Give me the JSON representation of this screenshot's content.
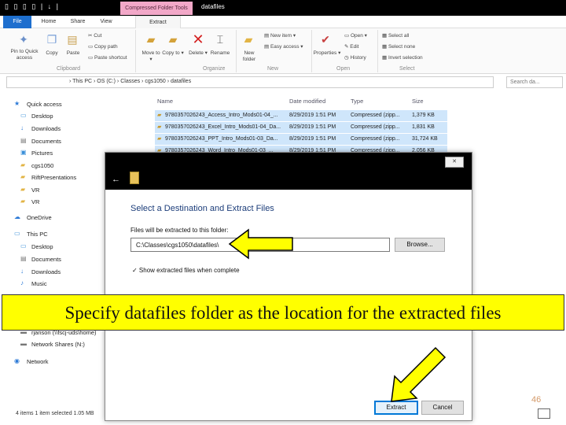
{
  "titlebar": {
    "qat": "▯ ▯ ▯ ▯ | ↓ |",
    "context_tab": "Compressed Folder Tools",
    "window_title": "datafiles"
  },
  "ribbon_tabs": [
    "File",
    "Home",
    "Share",
    "View",
    "Extract"
  ],
  "ribbon": {
    "pin_label": "Pin to Quick access",
    "copy_label": "Copy",
    "paste_label": "Paste",
    "cut_label": "Cut",
    "copy_path_label": "Copy path",
    "paste_shortcut_label": "Paste shortcut",
    "move_to_label": "Move to ▾",
    "copy_to_label": "Copy to ▾",
    "delete_label": "Delete ▾",
    "rename_label": "Rename",
    "new_folder_label": "New folder",
    "new_item_label": "New item ▾",
    "easy_access_label": "Easy access ▾",
    "properties_label": "Properties ▾",
    "open_label": "Open ▾",
    "edit_label": "Edit",
    "history_label": "History",
    "select_all_label": "Select all",
    "select_none_label": "Select none",
    "invert_selection_label": "Invert selection",
    "groups": [
      "Clipboard",
      "Organize",
      "New",
      "Open",
      "Select"
    ]
  },
  "address": {
    "path": "› This PC › OS (C:) › Classes › cgs1050 › datafiles",
    "search_placeholder": "Search da..."
  },
  "nav": {
    "items": [
      "Quick access",
      "Desktop",
      "Downloads",
      "Documents",
      "Pictures",
      "cgs1050",
      "RiftPresentations",
      "VR",
      "VR",
      "OneDrive",
      "This PC",
      "Desktop",
      "Documents",
      "Downloads",
      "Music",
      "rjanson (\\\\fscj-uds\\home)",
      "Network Shares (N:)",
      "Network"
    ]
  },
  "file_list": {
    "headers": [
      "Name",
      "Date modified",
      "Type",
      "Size"
    ],
    "rows": [
      {
        "name": "9780357026243_Access_Intro_Mods01-04_...",
        "date": "8/29/2019 1:51 PM",
        "type": "Compressed (zipp...",
        "size": "1,379 KB"
      },
      {
        "name": "9780357026243_Excel_Intro_Mods01-04_Da...",
        "date": "8/29/2019 1:51 PM",
        "type": "Compressed (zipp...",
        "size": "1,831 KB"
      },
      {
        "name": "9780357026243_PPT_Intro_Mods01-03_Da...",
        "date": "8/29/2019 1:51 PM",
        "type": "Compressed (zipp...",
        "size": "31,724 KB"
      },
      {
        "name": "9780357026243_Word_Intro_Mods01-03_...",
        "date": "8/29/2019 1:51 PM",
        "type": "Compressed (zipp...",
        "size": "2,056 KB"
      }
    ]
  },
  "status": {
    "text": "4 items   1 item selected  1.05 MB"
  },
  "dialog": {
    "close_label": "✕",
    "heading": "Select a Destination and Extract Files",
    "field_label": "Files will be extracted to this folder:",
    "path_value": "C:\\Classes\\cgs1050\\datafiles\\",
    "browse_label": "Browse...",
    "show_files_label": "✓  Show extracted files when complete",
    "extract_label": "Extract",
    "cancel_label": "Cancel"
  },
  "caption": "Specify datafiles folder as the location for the extracted files",
  "slide_number": "46",
  "colors": {
    "accent": "#1e6fce",
    "caption_bg": "#ffff00",
    "arrow_fill": "#ffff00",
    "context_tab": "#f2a8c8",
    "row_selected": "#cfe6fb"
  }
}
